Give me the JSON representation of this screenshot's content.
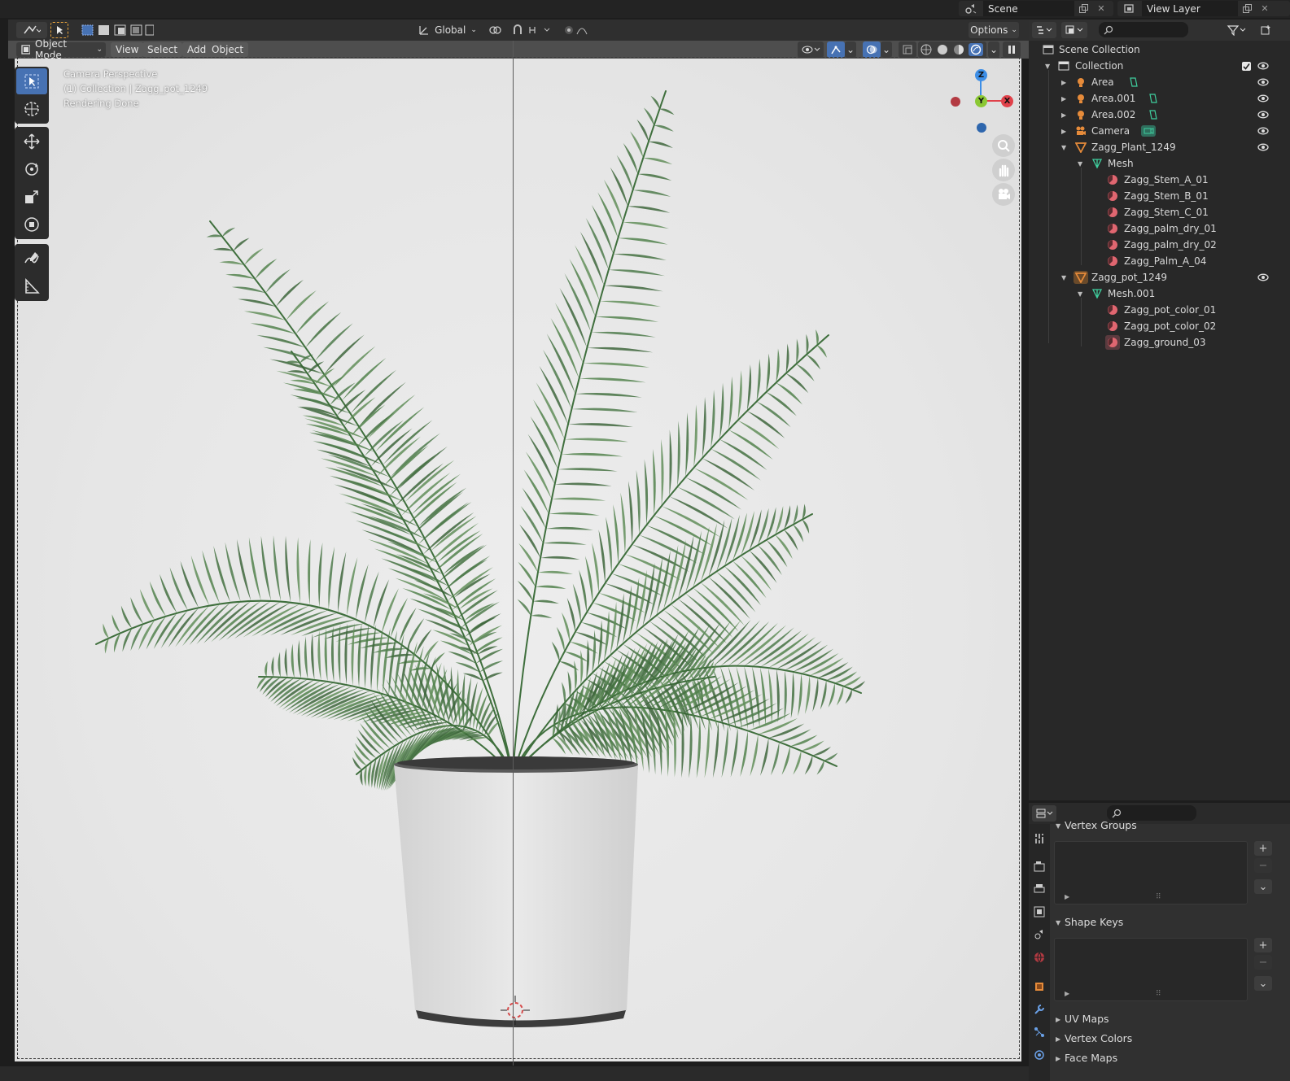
{
  "topbar": {
    "scene_label": "Scene",
    "view_layer_label": "View Layer"
  },
  "viewport_header": {
    "transform_orientation": "Global",
    "options_label": "Options"
  },
  "viewport_menu": {
    "mode": "Object Mode",
    "items": [
      "View",
      "Select",
      "Add",
      "Object"
    ]
  },
  "viewport_overlay": {
    "line1": "Camera Perspective",
    "line2": "(1) Collection | Zagg_pot_1249",
    "line3": "Rendering Done"
  },
  "gizmo": {
    "z": "Z",
    "y": "Y",
    "x": "X"
  },
  "outliner": {
    "scene_collection": "Scene Collection",
    "collection": "Collection",
    "items": [
      {
        "label": "Area"
      },
      {
        "label": "Area.001"
      },
      {
        "label": "Area.002"
      },
      {
        "label": "Camera"
      },
      {
        "label": "Zagg_Plant_1249"
      },
      {
        "label": "Mesh"
      },
      {
        "label": "Zagg_Stem_A_01"
      },
      {
        "label": "Zagg_Stem_B_01"
      },
      {
        "label": "Zagg_Stem_C_01"
      },
      {
        "label": "Zagg_palm_dry_01"
      },
      {
        "label": "Zagg_palm_dry_02"
      },
      {
        "label": "Zagg_Palm_A_04"
      },
      {
        "label": "Zagg_pot_1249"
      },
      {
        "label": "Mesh.001"
      },
      {
        "label": "Zagg_pot_color_01"
      },
      {
        "label": "Zagg_pot_color_02"
      },
      {
        "label": "Zagg_ground_03"
      }
    ]
  },
  "properties": {
    "vertex_groups": "Vertex Groups",
    "shape_keys": "Shape Keys",
    "uv_maps": "UV Maps",
    "vertex_colors": "Vertex Colors",
    "face_maps": "Face Maps"
  },
  "colors": {
    "accent": "#4772b3",
    "axis_x": "#e0414a",
    "axis_y": "#8bc834",
    "axis_z": "#3d8ee6",
    "material": "#e06670",
    "object": "#e68b3a",
    "mesh": "#3fcf9e"
  }
}
